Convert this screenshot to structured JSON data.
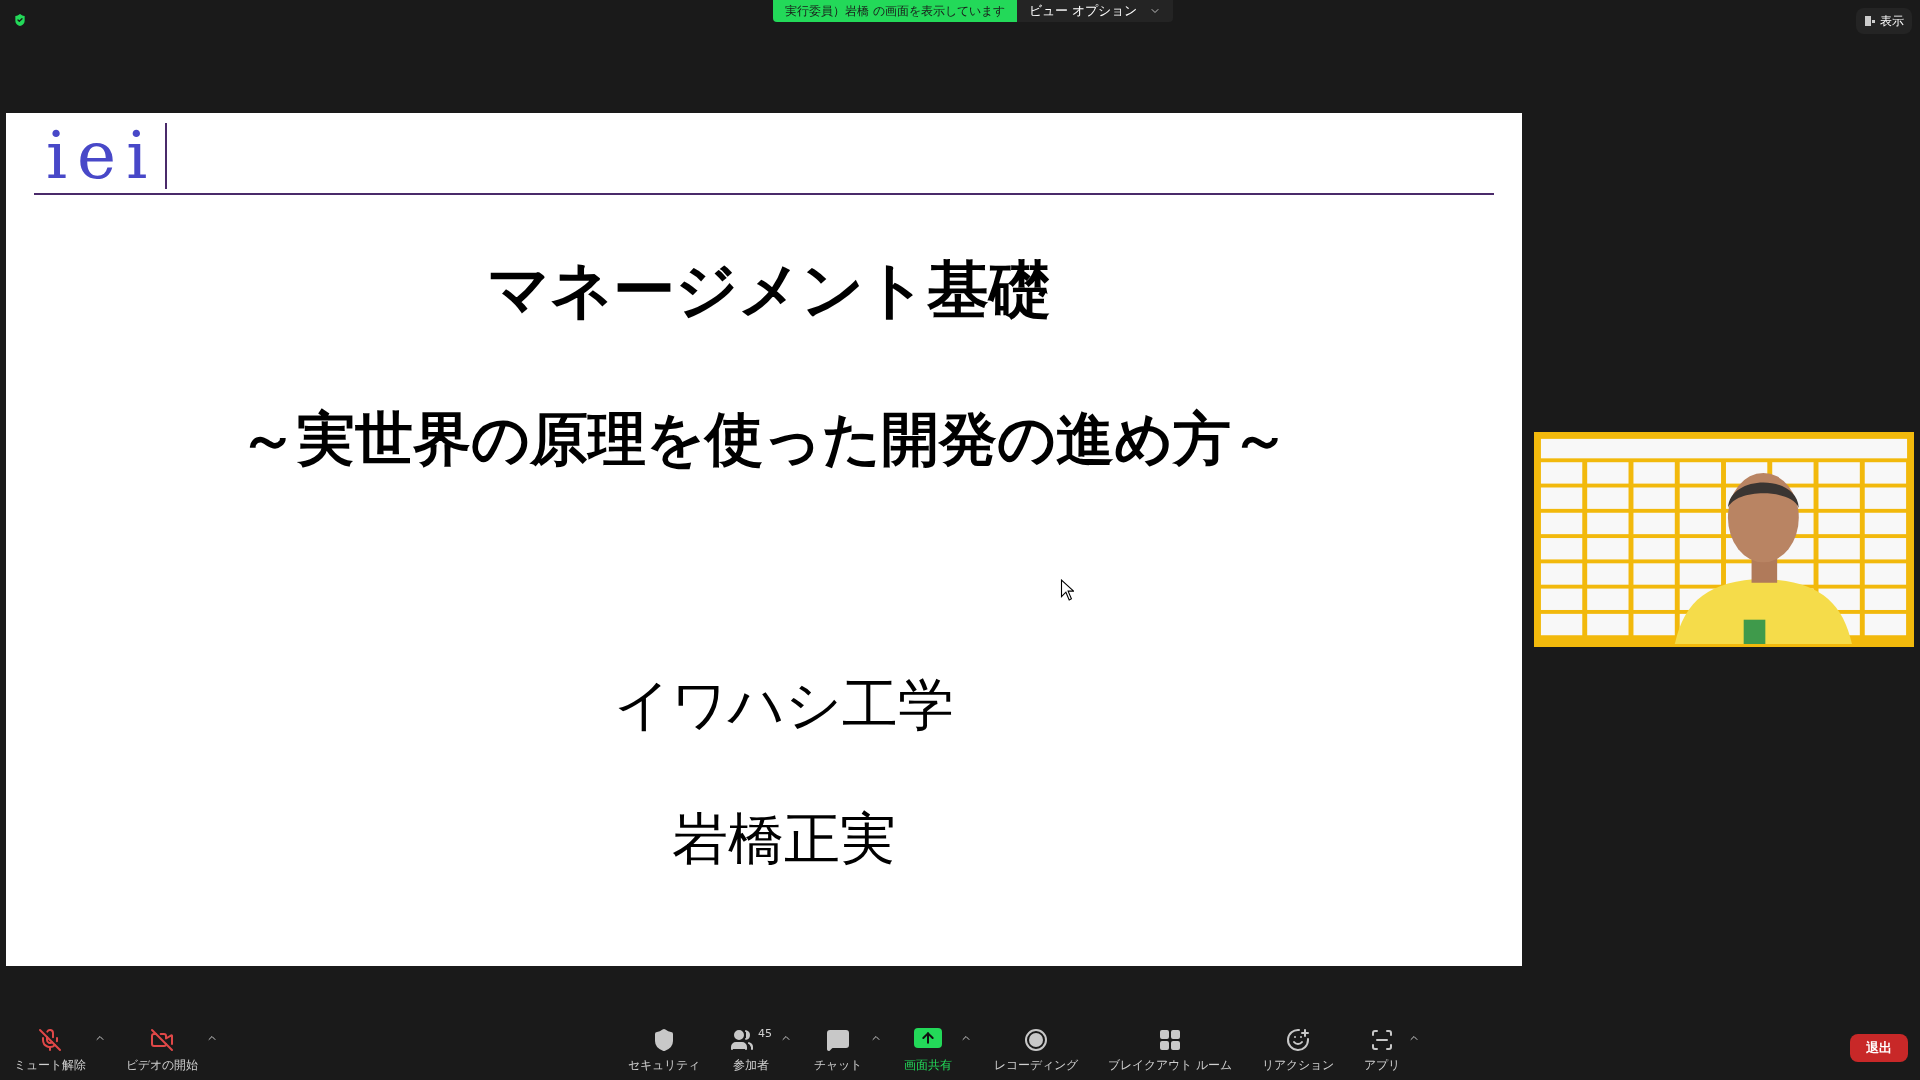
{
  "share_banner": {
    "text": "実行委員）岩橋 の画面を表示しています"
  },
  "view_options": {
    "label": "ビュー オプション"
  },
  "view_button": {
    "label": "表示"
  },
  "slide": {
    "logo": "iei",
    "title": "マネージメント基礎",
    "subtitle": "～実世界の原理を使った開発の進め方～",
    "organization": "イワハシ工学",
    "author": "岩橋正実"
  },
  "toolbar": {
    "left": [
      {
        "kind": "mic",
        "label": "ミュート解除",
        "off": true
      },
      {
        "kind": "video",
        "label": "ビデオの開始",
        "off": true
      }
    ],
    "center": [
      {
        "kind": "security",
        "label": "セキュリティ"
      },
      {
        "kind": "participants",
        "label": "参加者",
        "count": "45"
      },
      {
        "kind": "chat",
        "label": "チャット"
      },
      {
        "kind": "share",
        "label": "画面共有"
      },
      {
        "kind": "record",
        "label": "レコーディング"
      },
      {
        "kind": "breakout",
        "label": "ブレイクアウト ルーム"
      },
      {
        "kind": "reaction",
        "label": "リアクション"
      },
      {
        "kind": "apps",
        "label": "アプリ"
      }
    ],
    "leave": "退出"
  }
}
